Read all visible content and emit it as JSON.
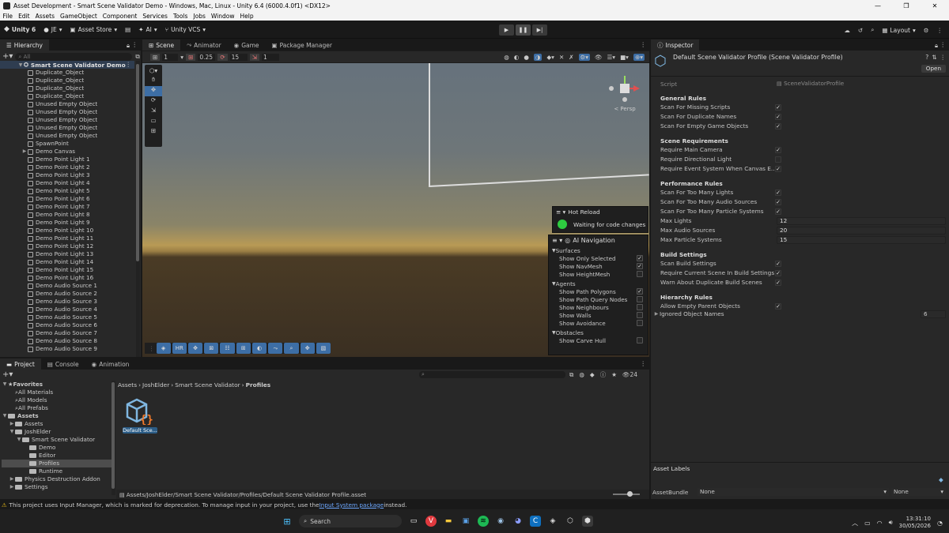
{
  "window": {
    "title": "Asset Development - Smart Scene Validator Demo - Windows, Mac, Linux - Unity 6.4 (6000.4.0f1) <DX12>",
    "minimize": "—",
    "maximize": "❐",
    "close": "✕"
  },
  "menu": [
    "File",
    "Edit",
    "Assets",
    "GameObject",
    "Component",
    "Services",
    "Tools",
    "Jobs",
    "Window",
    "Help"
  ],
  "toolbar": {
    "unity": "Unity 6",
    "account": "JE",
    "asset_store": "Asset Store",
    "ai": "AI",
    "vcs": "Unity VCS",
    "layout": "Layout"
  },
  "hierarchy": {
    "tab": "Hierarchy",
    "search_placeholder": "All",
    "scene": "Smart Scene Validator Demo",
    "items": [
      "Duplicate_Object",
      "Duplicate_Object",
      "Duplicate_Object",
      "Duplicate_Object",
      "Unused Empty Object",
      "Unused Empty Object",
      "Unused Empty Object",
      "Unused Empty Object",
      "Unused Empty Object",
      "SpawnPoint",
      "Demo Canvas",
      "Demo Point Light 1",
      "Demo Point Light 2",
      "Demo Point Light 3",
      "Demo Point Light 4",
      "Demo Point Light 5",
      "Demo Point Light 6",
      "Demo Point Light 7",
      "Demo Point Light 8",
      "Demo Point Light 9",
      "Demo Point Light 10",
      "Demo Point Light 11",
      "Demo Point Light 12",
      "Demo Point Light 13",
      "Demo Point Light 14",
      "Demo Point Light 15",
      "Demo Point Light 16",
      "Demo Audio Source 1",
      "Demo Audio Source 2",
      "Demo Audio Source 3",
      "Demo Audio Source 4",
      "Demo Audio Source 5",
      "Demo Audio Source 6",
      "Demo Audio Source 7",
      "Demo Audio Source 8",
      "Demo Audio Source 9"
    ]
  },
  "scene_tabs": [
    "Scene",
    "Animator",
    "Game",
    "Package Manager"
  ],
  "scene_toolbar": {
    "grid": "1",
    "snap": "0.25",
    "rot": "15",
    "scale": "1"
  },
  "gizmo": {
    "persp": "< Persp"
  },
  "hot_reload": {
    "title": "Hot Reload",
    "status": "Waiting for code changes",
    "status_color": "#2ecc40"
  },
  "ai_navigation": {
    "title": "AI Navigation",
    "sections": [
      {
        "name": "Surfaces",
        "items": [
          {
            "label": "Show Only Selected",
            "checked": true
          },
          {
            "label": "Show NavMesh",
            "checked": true
          },
          {
            "label": "Show HeightMesh",
            "checked": false
          }
        ]
      },
      {
        "name": "Agents",
        "items": [
          {
            "label": "Show Path Polygons",
            "checked": true
          },
          {
            "label": "Show Path Query Nodes",
            "checked": false
          },
          {
            "label": "Show Neighbours",
            "checked": false
          },
          {
            "label": "Show Walls",
            "checked": false
          },
          {
            "label": "Show Avoidance",
            "checked": false
          }
        ]
      },
      {
        "name": "Obstacles",
        "items": [
          {
            "label": "Show Carve Hull",
            "checked": false
          }
        ]
      }
    ]
  },
  "bottom_scene_toolbar": {
    "hr": "HR"
  },
  "project": {
    "tabs": [
      "Project",
      "Console",
      "Animation"
    ],
    "tree": [
      {
        "label": "Favorites",
        "level": 0,
        "bold": true
      },
      {
        "label": "All Materials",
        "level": 1
      },
      {
        "label": "All Models",
        "level": 1
      },
      {
        "label": "All Prefabs",
        "level": 1
      },
      {
        "label": "Assets",
        "level": 0,
        "bold": true
      },
      {
        "label": "Assets",
        "level": 1
      },
      {
        "label": "JoshElder",
        "level": 1
      },
      {
        "label": "Smart Scene Validator",
        "level": 2
      },
      {
        "label": "Demo",
        "level": 3
      },
      {
        "label": "Editor",
        "level": 3
      },
      {
        "label": "Profiles",
        "level": 3
      },
      {
        "label": "Runtime",
        "level": 3
      },
      {
        "label": "Physics Destruction Addon",
        "level": 1
      },
      {
        "label": "Settings",
        "level": 1
      }
    ],
    "breadcrumb": [
      "Assets",
      "JoshElder",
      "Smart Scene Validator",
      "Profiles"
    ],
    "asset_label": "Default Sce...",
    "path": "Assets/JoshElder/Smart Scene Validator/Profiles/Default Scene Validator Profile.asset",
    "count": "24"
  },
  "inspector": {
    "tab": "Inspector",
    "title": "Default Scene Validator Profile (Scene Validator Profile)",
    "open": "Open",
    "script_label": "Script",
    "script_value": "SceneValidatorProfile",
    "groups": [
      {
        "head": "General Rules",
        "rows": [
          {
            "label": "Scan For Missing Scripts",
            "checked": true
          },
          {
            "label": "Scan For Duplicate Names",
            "checked": true
          },
          {
            "label": "Scan For Empty Game Objects",
            "checked": true
          }
        ]
      },
      {
        "head": "Scene Requirements",
        "rows": [
          {
            "label": "Require Main Camera",
            "checked": true
          },
          {
            "label": "Require Directional Light",
            "checked": false
          },
          {
            "label": "Require Event System When Canvas E...",
            "checked": true
          }
        ]
      },
      {
        "head": "Performance Rules",
        "rows": [
          {
            "label": "Scan For Too Many Lights",
            "checked": true
          },
          {
            "label": "Scan For Too Many Audio Sources",
            "checked": true
          },
          {
            "label": "Scan For Too Many Particle Systems",
            "checked": true
          },
          {
            "label": "Max Lights",
            "value": "12"
          },
          {
            "label": "Max Audio Sources",
            "value": "20"
          },
          {
            "label": "Max Particle Systems",
            "value": "15"
          }
        ]
      },
      {
        "head": "Build Settings",
        "rows": [
          {
            "label": "Scan Build Settings",
            "checked": true
          },
          {
            "label": "Require Current Scene In Build Settings",
            "checked": true
          },
          {
            "label": "Warn About Duplicate Build Scenes",
            "checked": true
          }
        ]
      },
      {
        "head": "Hierarchy Rules",
        "rows": [
          {
            "label": "Allow Empty Parent Objects",
            "checked": true
          }
        ]
      }
    ],
    "ignored_label": "Ignored Object Names",
    "ignored_count": "6",
    "asset_labels": "Asset Labels",
    "asset_bundle_label": "AssetBundle",
    "asset_bundle": "None",
    "asset_variant": "None"
  },
  "status": {
    "warning": "This project uses Input Manager, which is marked for deprecation. To manage input in your project, use the ",
    "link": "Input System package",
    "after": " instead."
  },
  "taskbar": {
    "search": "Search",
    "time": "13:31:10",
    "date": "30/05/2026"
  }
}
